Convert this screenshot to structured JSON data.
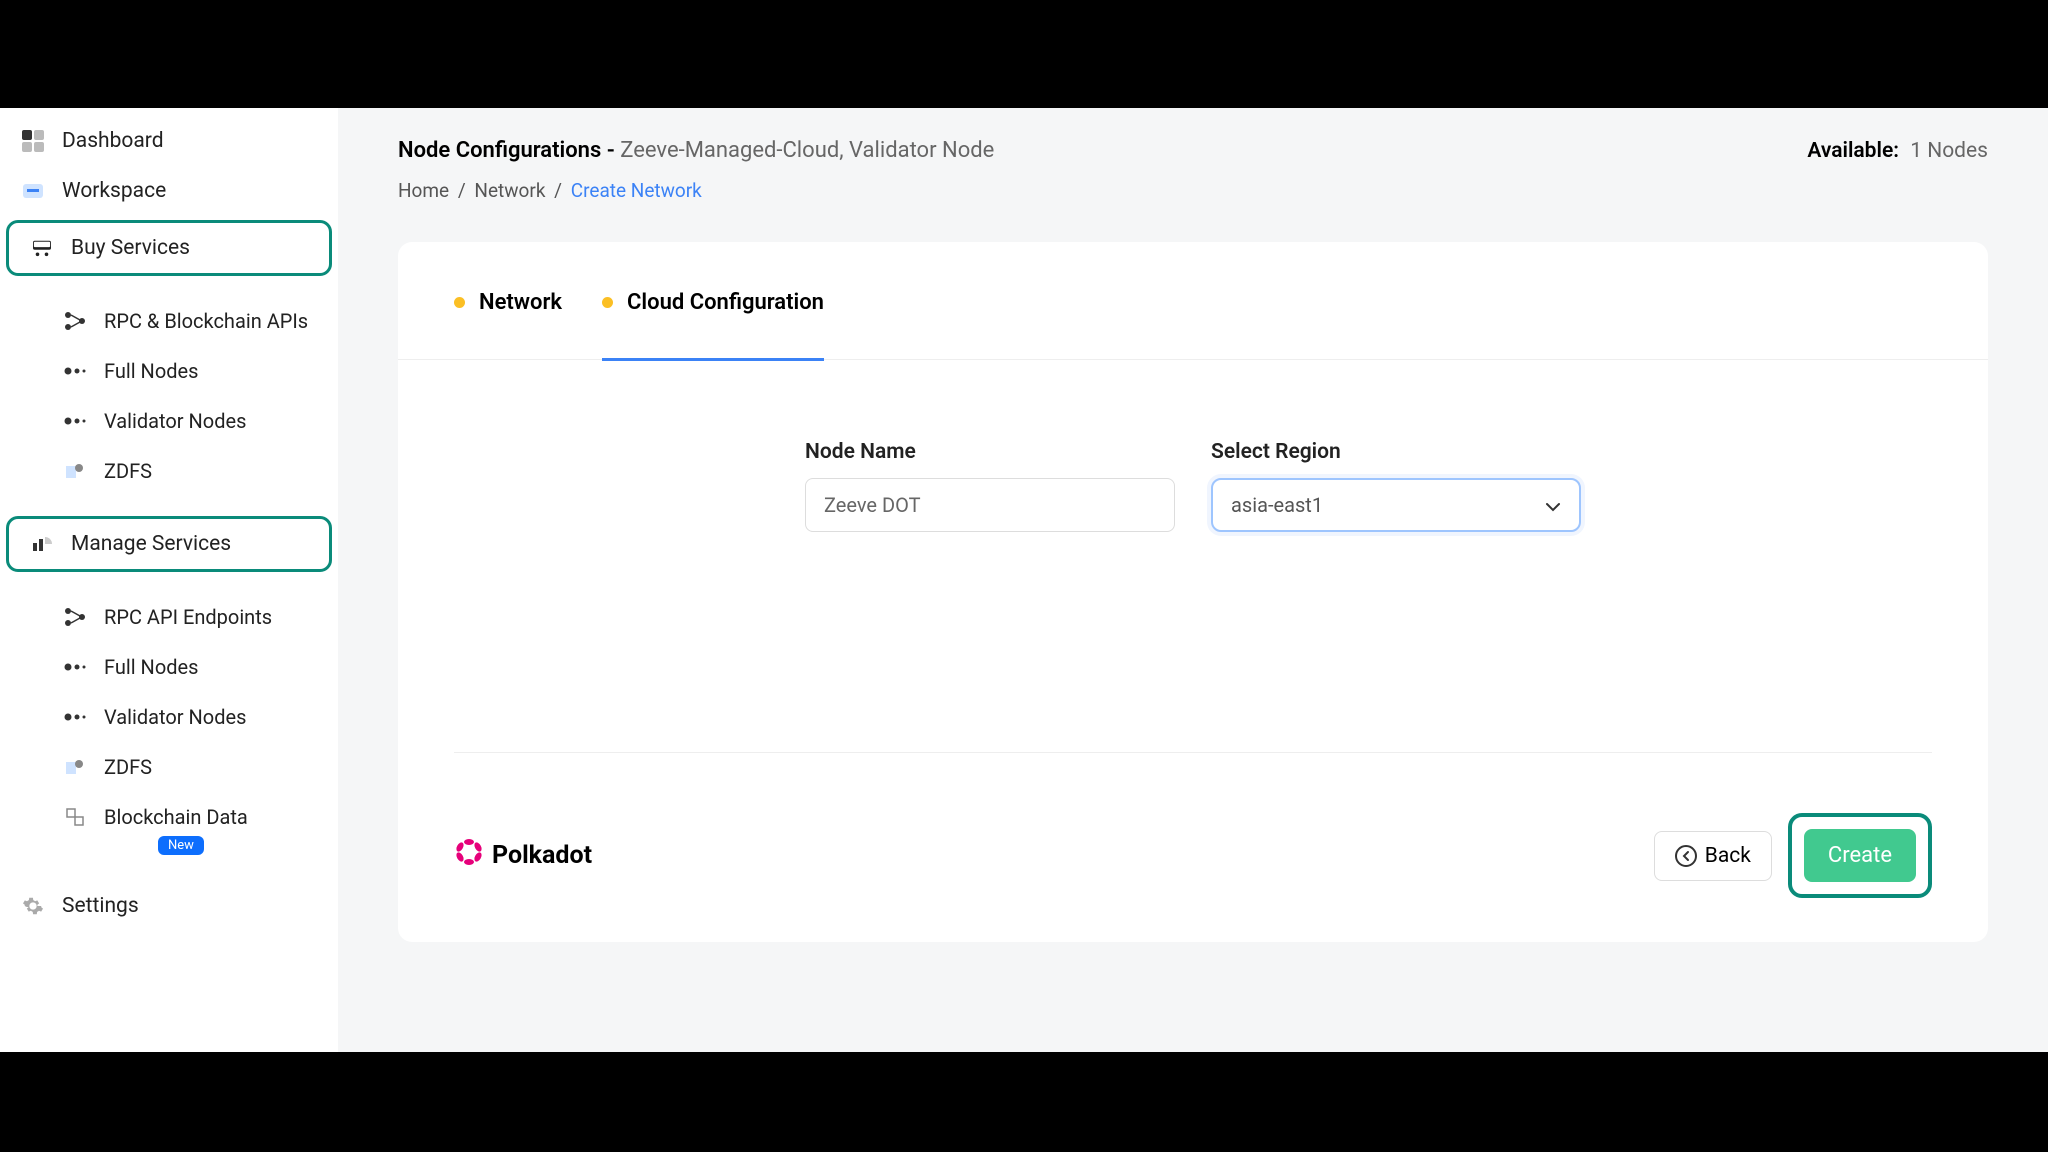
{
  "sidebar": {
    "dashboard": "Dashboard",
    "workspace": "Workspace",
    "buy_services": "Buy Services",
    "buy": {
      "rpc_apis": "RPC & Blockchain APIs",
      "full_nodes": "Full Nodes",
      "validator_nodes": "Validator Nodes",
      "zdfs": "ZDFS"
    },
    "manage_services": "Manage Services",
    "manage": {
      "rpc_endpoints": "RPC API Endpoints",
      "full_nodes": "Full Nodes",
      "validator_nodes": "Validator Nodes",
      "zdfs": "ZDFS",
      "blockchain_data": "Blockchain Data",
      "new_badge": "New"
    },
    "settings": "Settings"
  },
  "header": {
    "title_prefix": "Node Configurations - ",
    "title_suffix": " Zeeve-Managed-Cloud,  Validator Node",
    "available_label": "Available:",
    "available_value": "1 Nodes"
  },
  "breadcrumb": {
    "home": "Home",
    "network": "Network",
    "current": "Create Network"
  },
  "tabs": {
    "network": "Network",
    "cloud": "Cloud Configuration"
  },
  "form": {
    "node_name_label": "Node Name",
    "node_name_value": "Zeeve DOT",
    "region_label": "Select Region",
    "region_value": "asia-east1"
  },
  "footer": {
    "brand": "Polkadot",
    "back": "Back",
    "create": "Create"
  }
}
